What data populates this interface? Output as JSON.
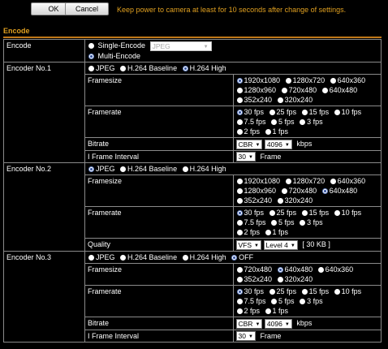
{
  "toolbar": {
    "ok_label": "OK",
    "cancel_label": "Cancel",
    "notice": "Keep power to camera at least for 10 seconds after change of settings."
  },
  "section": {
    "title": "Encode"
  },
  "encode": {
    "label": "Encode",
    "single_label": "Single-Encode",
    "single_select": "JPEG",
    "multi_label": "Multi-Encode",
    "selected": "Multi-Encode"
  },
  "encoder1": {
    "label": "Encoder No.1",
    "codecs": [
      "JPEG",
      "H.264 Baseline",
      "H.264 High"
    ],
    "codec_selected": "H.264 High",
    "framesize_label": "Framesize",
    "framesizes_row1": [
      "1920x1080",
      "1280x720",
      "640x360"
    ],
    "framesizes_row2": [
      "1280x960",
      "720x480",
      "640x480",
      "352x240",
      "320x240"
    ],
    "framesize_selected": "1920x1080",
    "framerate_label": "Framerate",
    "framerates_row1": [
      "30 fps",
      "25 fps",
      "15 fps",
      "10 fps",
      "7.5 fps",
      "5 fps",
      "3 fps"
    ],
    "framerates_row2": [
      "2 fps",
      "1 fps"
    ],
    "framerate_selected": "30 fps",
    "bitrate_label": "Bitrate",
    "bitrate_mode": "CBR",
    "bitrate_value": "4096",
    "bitrate_unit": "kbps",
    "iframe_label": "I Frame Interval",
    "iframe_value": "30",
    "iframe_unit": "Frame"
  },
  "encoder2": {
    "label": "Encoder No.2",
    "codecs": [
      "JPEG",
      "H.264 Baseline",
      "H.264 High"
    ],
    "codec_selected": "JPEG",
    "framesize_label": "Framesize",
    "framesizes_row1": [
      "1920x1080",
      "1280x720",
      "640x360"
    ],
    "framesizes_row2": [
      "1280x960",
      "720x480",
      "640x480",
      "352x240",
      "320x240"
    ],
    "framesize_selected": "640x480",
    "framerate_label": "Framerate",
    "framerates_row1": [
      "30 fps",
      "25 fps",
      "15 fps",
      "10 fps",
      "7.5 fps",
      "5 fps",
      "3 fps"
    ],
    "framerates_row2": [
      "2 fps",
      "1 fps"
    ],
    "framerate_selected": "30 fps",
    "quality_label": "Quality",
    "quality_mode": "VFS",
    "quality_level": "Level 4",
    "quality_size": "[ 30 KB ]"
  },
  "encoder3": {
    "label": "Encoder No.3",
    "codecs": [
      "JPEG",
      "H.264 Baseline",
      "H.264 High",
      "OFF"
    ],
    "codec_selected": "OFF",
    "framesize_label": "Framesize",
    "framesizes_row1": [
      "720x480",
      "640x480",
      "640x360",
      "352x240",
      "320x240"
    ],
    "framesize_selected": "640x480",
    "framerate_label": "Framerate",
    "framerates_row1": [
      "30 fps",
      "25 fps",
      "15 fps",
      "10 fps",
      "7.5 fps",
      "5 fps",
      "3 fps"
    ],
    "framerates_row2": [
      "2 fps",
      "1 fps"
    ],
    "framerate_selected": "30 fps",
    "bitrate_label": "Bitrate",
    "bitrate_mode": "CBR",
    "bitrate_value": "4096",
    "bitrate_unit": "kbps",
    "iframe_label": "I Frame Interval",
    "iframe_value": "30",
    "iframe_unit": "Frame"
  },
  "colors": {
    "accent": "#e0a020",
    "section_line": "#c07818",
    "background": "#000000",
    "border": "#8a8a8a"
  }
}
